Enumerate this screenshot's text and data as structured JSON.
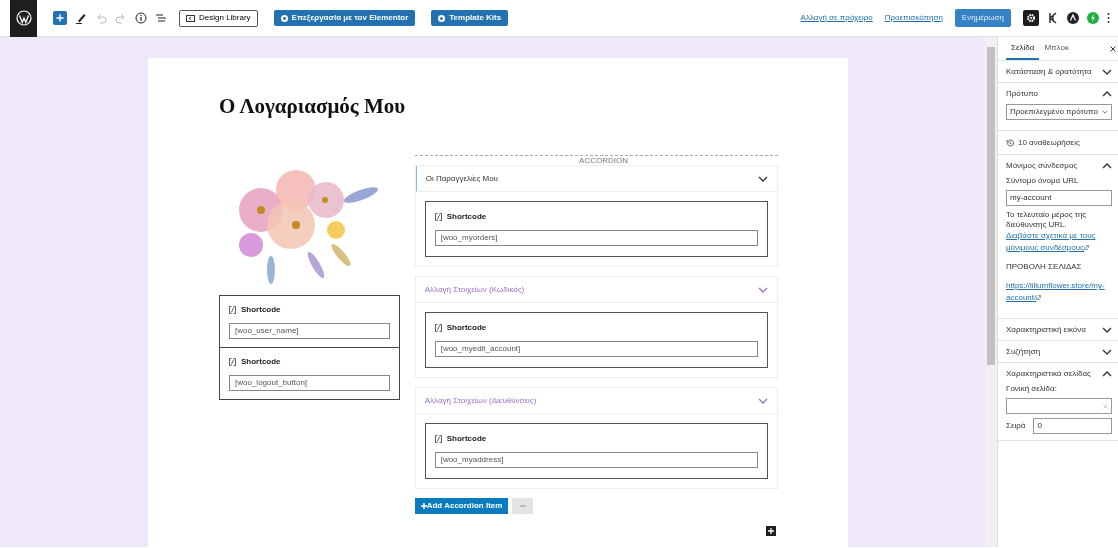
{
  "toolbar": {
    "tool_buttons": [
      {
        "label": "Design Library",
        "kind": "outline"
      },
      {
        "label": "Επεξεργασία με τον Elementor",
        "kind": "primary"
      },
      {
        "label": "Template Kits",
        "kind": "primary"
      }
    ],
    "links": [
      "Αλλαγή σε πρόχειρο",
      "Προεπισκόπηση"
    ],
    "update_button": "Ενημέρωση",
    "settings_pressed": true
  },
  "page": {
    "title": "Ο Λογαριασμός Μου",
    "left_shortcodes": [
      {
        "label": "Shortcode",
        "value": "[woo_user_name]"
      },
      {
        "label": "Shortcode",
        "value": "[woo_logout_button]"
      }
    ],
    "accordion": {
      "label": "ACCORDION",
      "items": [
        {
          "title": "Οι Παραγγελίες Μου",
          "selected": true,
          "expanded": true,
          "shortcode": {
            "label": "Shortcode",
            "value": "[woo_myorders]"
          }
        },
        {
          "title": "Αλλαγή Στοιχείων (Κωδικός)",
          "selected": false,
          "expanded": true,
          "shortcode": {
            "label": "Shortcode",
            "value": "[woo_myedit_account]"
          }
        },
        {
          "title": "Αλλαγή Στοιχείων (Διευθύνσεις)",
          "selected": false,
          "expanded": true,
          "shortcode": {
            "label": "Shortcode",
            "value": "[woo_myaddress]"
          }
        }
      ],
      "add_button": "Add Accordion Item"
    }
  },
  "sidebar": {
    "tabs": [
      {
        "label": "Σελίδα",
        "selected": true
      },
      {
        "label": "Μπλοκ",
        "selected": false
      }
    ],
    "panels": [
      {
        "kind": "section",
        "title": "Κατάσταση & ορατότητα",
        "expanded": false
      },
      {
        "kind": "section",
        "title": "Πρότυπο",
        "expanded": true,
        "content": [
          {
            "kind": "select",
            "value": "Προεπιλεγμένο πρότυπο"
          }
        ]
      },
      {
        "kind": "revisions",
        "content": [
          {
            "kind": "revisions",
            "text": "10 αναθεωρήσεις"
          }
        ]
      },
      {
        "kind": "section",
        "title": "Μόνιμος σύνδεσμος",
        "expanded": true,
        "content": [
          {
            "kind": "label",
            "text": "Σύντομο όνομα URL"
          },
          {
            "kind": "input",
            "value": "my-account"
          },
          {
            "kind": "text",
            "text": "Το τελευταίο μέρος της διεύθυνσης URL."
          },
          {
            "kind": "link",
            "text": "Διαβάστε σχετικά με τους μόνιμους συνδέσμους"
          },
          {
            "kind": "heading",
            "text": "ΠΡΟΒΟΛΗ ΣΕΛΙΔΑΣ"
          },
          {
            "kind": "link",
            "text": "https://liliumflower.store/my-account/"
          }
        ]
      },
      {
        "kind": "section",
        "title": "Χαρακτηριστική εικόνα",
        "expanded": false
      },
      {
        "kind": "section",
        "title": "Συζήτηση",
        "expanded": false
      },
      {
        "kind": "section",
        "title": "Χαρακτηριστικά σελίδας",
        "expanded": true,
        "content": [
          {
            "kind": "label",
            "text": "Γονική σελίδα:"
          },
          {
            "kind": "combobox"
          },
          {
            "kind": "order",
            "label": "Σειρά",
            "value": "0"
          }
        ]
      }
    ]
  }
}
